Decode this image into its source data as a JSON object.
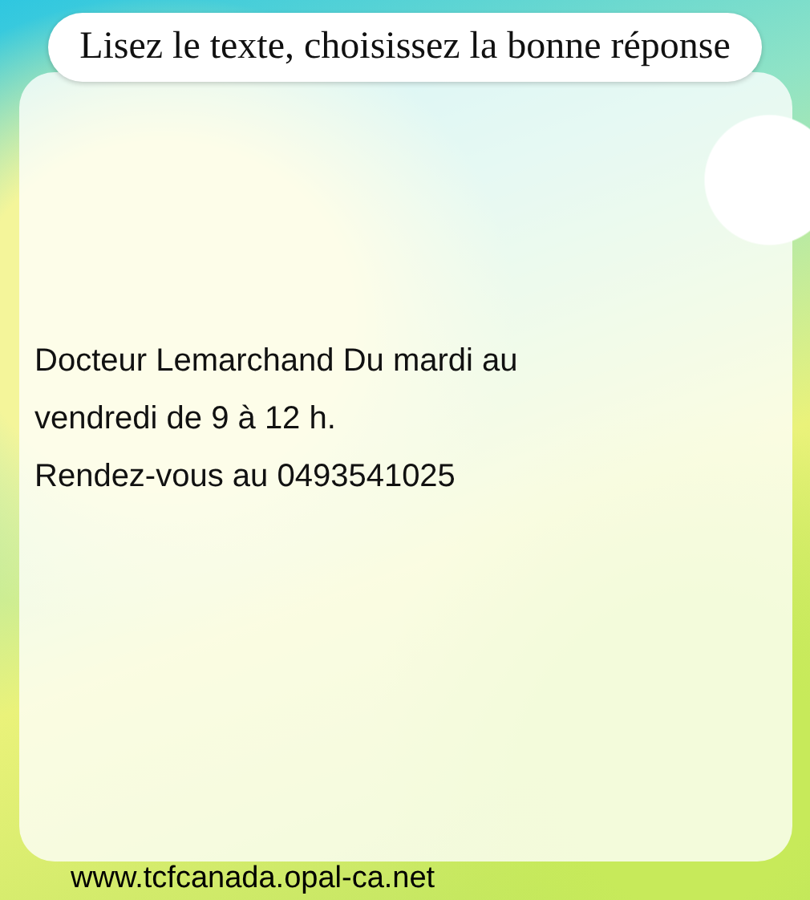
{
  "header": {
    "title": "Lisez le texte, choisissez la bonne réponse"
  },
  "card": {
    "lines": [
      "Docteur Lemarchand Du mardi au",
      "vendredi de 9 à 12 h.",
      "Rendez-vous au 0493541025"
    ]
  },
  "footer": {
    "url": "www.tcfcanada.opal-ca.net"
  }
}
